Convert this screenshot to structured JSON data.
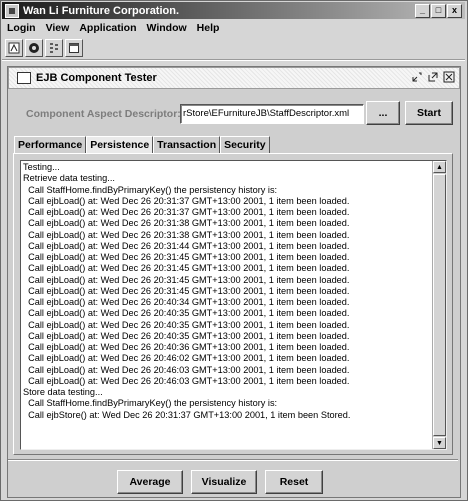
{
  "window": {
    "title": "Wan Li Furniture Corporation.",
    "controls": [
      "_",
      "□",
      "x"
    ]
  },
  "menubar": [
    "Login",
    "View",
    "Application",
    "Window",
    "Help"
  ],
  "toolbar": {
    "icons": [
      "login-icon",
      "settings-icon",
      "tree-icon",
      "window-icon"
    ]
  },
  "internal_frame": {
    "title": "EJB Component Tester",
    "controls": [
      "minimize",
      "maximize",
      "close"
    ]
  },
  "descriptor": {
    "label": "Component Aspect Descriptor:",
    "value": "rStore\\EFurnitureJB\\StaffDescriptor.xml",
    "browse_label": "...",
    "start_label": "Start"
  },
  "tabs": [
    "Performance",
    "Persistence",
    "Transaction",
    "Security"
  ],
  "active_tab": "Persistence",
  "log_lines": [
    "Testing...",
    "Retrieve data testing...",
    "  Call StaffHome.findByPrimaryKey() the persistency history is:",
    "  Call ejbLoad() at: Wed Dec 26 20:31:37 GMT+13:00 2001, 1 item been loaded.",
    "  Call ejbLoad() at: Wed Dec 26 20:31:37 GMT+13:00 2001, 1 item been loaded.",
    "  Call ejbLoad() at: Wed Dec 26 20:31:38 GMT+13:00 2001, 1 item been loaded.",
    "  Call ejbLoad() at: Wed Dec 26 20:31:38 GMT+13:00 2001, 1 item been loaded.",
    "  Call ejbLoad() at: Wed Dec 26 20:31:44 GMT+13:00 2001, 1 item been loaded.",
    "  Call ejbLoad() at: Wed Dec 26 20:31:45 GMT+13:00 2001, 1 item been loaded.",
    "  Call ejbLoad() at: Wed Dec 26 20:31:45 GMT+13:00 2001, 1 item been loaded.",
    "  Call ejbLoad() at: Wed Dec 26 20:31:45 GMT+13:00 2001, 1 item been loaded.",
    "  Call ejbLoad() at: Wed Dec 26 20:31:45 GMT+13:00 2001, 1 item been loaded.",
    "  Call ejbLoad() at: Wed Dec 26 20:40:34 GMT+13:00 2001, 1 item been loaded.",
    "  Call ejbLoad() at: Wed Dec 26 20:40:35 GMT+13:00 2001, 1 item been loaded.",
    "  Call ejbLoad() at: Wed Dec 26 20:40:35 GMT+13:00 2001, 1 item been loaded.",
    "  Call ejbLoad() at: Wed Dec 26 20:40:35 GMT+13:00 2001, 1 item been loaded.",
    "  Call ejbLoad() at: Wed Dec 26 20:40:36 GMT+13:00 2001, 1 item been loaded.",
    "  Call ejbLoad() at: Wed Dec 26 20:46:02 GMT+13:00 2001, 1 item been loaded.",
    "  Call ejbLoad() at: Wed Dec 26 20:46:03 GMT+13:00 2001, 1 item been loaded.",
    "  Call ejbLoad() at: Wed Dec 26 20:46:03 GMT+13:00 2001, 1 item been loaded.",
    "Store data testing...",
    "  Call StaffHome.findByPrimaryKey() the persistency history is:",
    "  Call ejbStore() at: Wed Dec 26 20:31:37 GMT+13:00 2001, 1 item been Stored."
  ],
  "buttons": {
    "average": "Average",
    "visualize": "Visualize",
    "reset": "Reset"
  }
}
